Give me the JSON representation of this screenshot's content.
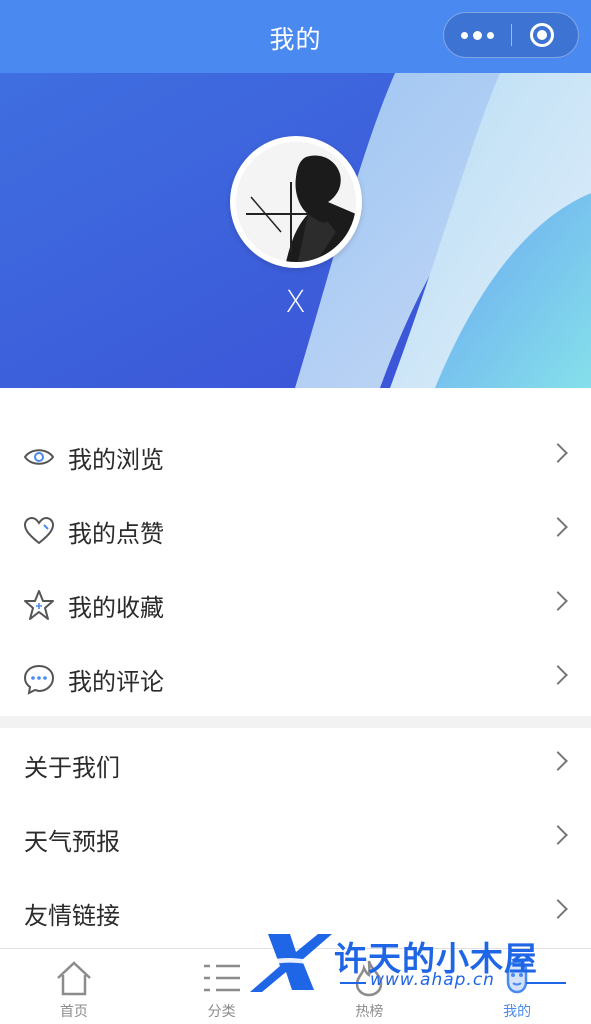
{
  "navbar": {
    "title": "我的",
    "capsule_more_icon": "more-dots-icon",
    "capsule_close_icon": "target-circle-icon",
    "bg_color": "#4a8af0"
  },
  "profile": {
    "username": "X",
    "avatar_alt": "avatar"
  },
  "menu_primary": [
    {
      "label": "我的浏览",
      "icon": "eye-icon"
    },
    {
      "label": "我的点赞",
      "icon": "heart-icon"
    },
    {
      "label": "我的收藏",
      "icon": "star-icon"
    },
    {
      "label": "我的评论",
      "icon": "comment-icon"
    }
  ],
  "menu_secondary": [
    {
      "label": "关于我们"
    },
    {
      "label": "天气预报"
    },
    {
      "label": "友情链接"
    }
  ],
  "tabbar": [
    {
      "label": "首页",
      "icon": "home-icon",
      "active": false
    },
    {
      "label": "分类",
      "icon": "list-icon",
      "active": false
    },
    {
      "label": "热榜",
      "icon": "flame-icon",
      "active": false
    },
    {
      "label": "我的",
      "icon": "user-icon",
      "active": true
    }
  ],
  "watermark": {
    "title": "许天的小木屋",
    "url": "www.ahap.cn"
  },
  "colors": {
    "primary": "#4a8af0",
    "active_tab": "#4a8af0",
    "icon_gray": "#555555",
    "watermark": "#1f66e6"
  }
}
